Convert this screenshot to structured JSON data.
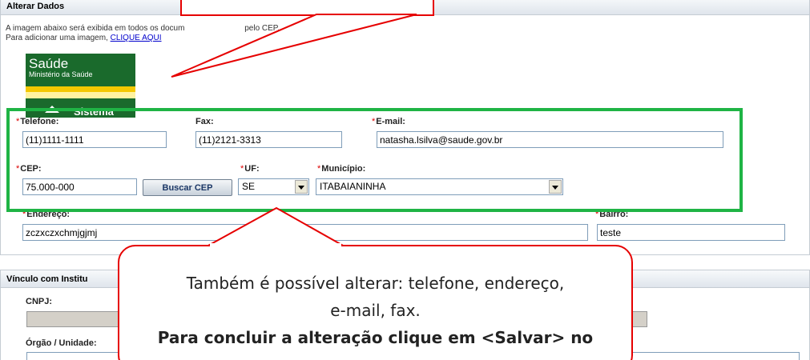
{
  "alterar": {
    "title": "Alterar Dados",
    "info_line1_a": "A imagem abaixo será exibida em todos os docum",
    "info_line1_b": "pelo CEP.",
    "info_line2_prefix": "Para adicionar uma imagem,",
    "info_link": "CLIQUE AQUI"
  },
  "logo": {
    "title": "Saúde",
    "subtitle": "Ministério da Saúde",
    "bottom_text": "Sistema"
  },
  "form": {
    "required_mark": "*",
    "telefone": {
      "label": "Telefone:",
      "value": "(11)1111-1111"
    },
    "fax": {
      "label": "Fax:",
      "value": "(11)2121-3313"
    },
    "email": {
      "label": "E-mail:",
      "value": "natasha.lsilva@saude.gov.br"
    },
    "cep": {
      "label": "CEP:",
      "value": "75.000-000"
    },
    "buscar_cep": "Buscar CEP",
    "uf": {
      "label": "UF:",
      "value": "SE"
    },
    "municipio": {
      "label": "Município:",
      "value": "ITABAIANINHA"
    },
    "endereco": {
      "label": "Endereço:",
      "value": "zczxczxchmjgjmj"
    },
    "bairro": {
      "label": "Bairro:",
      "value": "teste"
    }
  },
  "vinculo": {
    "title": "Vínculo com Institu",
    "cnpj_label": "CNPJ:",
    "orgao_label": "Órgão / Unidade:"
  },
  "callout": {
    "line1": "Também é possível alterar: telefone, endereço,",
    "line2": "e-mail, fax.",
    "line3": "Para concluir a alteração clique em <Salvar> no"
  },
  "colors": {
    "highlight_green": "#1fb445",
    "callout_red": "#e60000",
    "link_blue": "#0000cc"
  }
}
